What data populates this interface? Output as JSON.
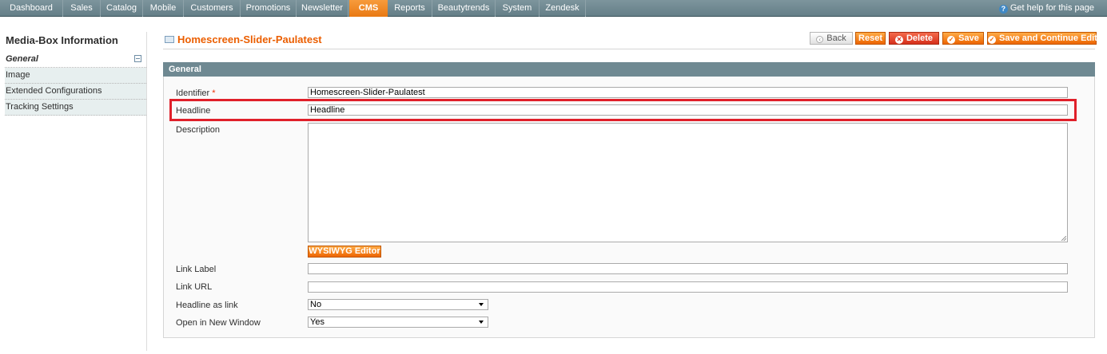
{
  "nav": {
    "items": [
      "Dashboard",
      "Sales",
      "Catalog",
      "Mobile",
      "Customers",
      "Promotions",
      "Newsletter",
      "CMS",
      "Reports",
      "Beautytrends",
      "System",
      "Zendesk"
    ],
    "active": "CMS",
    "help": "Get help for this page"
  },
  "sidebar": {
    "title": "Media-Box Information",
    "tabs": [
      "General",
      "Image",
      "Extended Configurations",
      "Tracking Settings"
    ],
    "active_tab": "General"
  },
  "header": {
    "title": "Homescreen-Slider-Paulatest",
    "buttons": {
      "back": "Back",
      "reset": "Reset",
      "delete": "Delete",
      "save": "Save",
      "save_continue": "Save and Continue Edit"
    }
  },
  "fieldset": {
    "title": "General",
    "identifier": {
      "label": "Identifier",
      "required_mark": "*",
      "value": "Homescreen-Slider-Paulatest"
    },
    "headline": {
      "label": "Headline",
      "value": "Headline"
    },
    "description": {
      "label": "Description",
      "value": ""
    },
    "wysiwyg_button": "WYSIWYG Editor",
    "link_label": {
      "label": "Link Label",
      "value": ""
    },
    "link_url": {
      "label": "Link URL",
      "value": ""
    },
    "headline_as_link": {
      "label": "Headline as link",
      "value": "No"
    },
    "open_new_window": {
      "label": "Open in New Window",
      "value": "Yes"
    }
  },
  "colors": {
    "nav_bg": "#6f8992",
    "accent": "#eb5e00",
    "highlight": "#e0202a"
  }
}
